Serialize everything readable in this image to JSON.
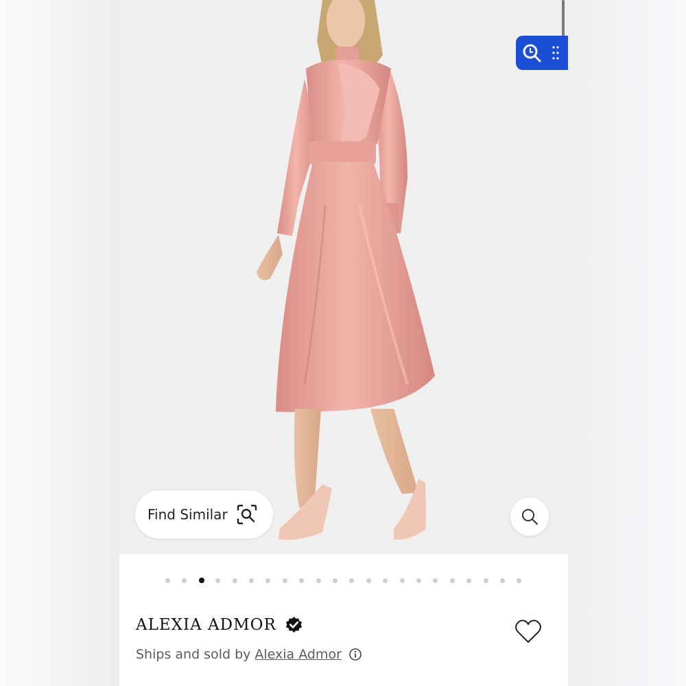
{
  "product": {
    "find_similar_label": "Find Similar",
    "brand": "ALEXIA ADMOR",
    "ships_prefix": "Ships and sold by",
    "seller": "Alexia Admor"
  },
  "carousel": {
    "total": 22,
    "active_index": 2
  },
  "icons": {
    "lens": "visual-search-icon",
    "grip": "drag-grip-icon",
    "find_similar": "scan-search-icon",
    "zoom": "search-icon",
    "verified": "verified-badge-icon",
    "info": "info-icon",
    "wishlist": "heart-icon"
  },
  "colors": {
    "accent": "#1a4fd6",
    "dress": "#e8a49c",
    "background": "#efefef"
  }
}
